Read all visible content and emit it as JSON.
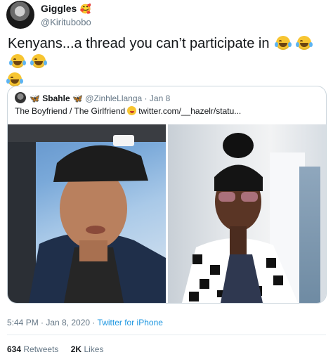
{
  "author": {
    "display_name": "Giggles",
    "name_emoji": "🥰",
    "handle": "@Kiritubobo"
  },
  "tweet": {
    "text": "Kenyans...a thread you can’t participate in"
  },
  "quoted": {
    "name": "Sbahle",
    "handle": "@ZinhleLlanga",
    "separator": "·",
    "date": "Jan 8",
    "text": "The Boyfriend / The Girlfriend",
    "link": "twitter.com/__hazelr/statu..."
  },
  "meta": {
    "time": "5:44 PM · Jan 8, 2020",
    "separator": "·",
    "source": "Twitter for iPhone"
  },
  "stats": {
    "retweets_count": "634",
    "retweets_label": "Retweets",
    "likes_count": "2K",
    "likes_label": "Likes"
  },
  "colors": {
    "text": "#14171a",
    "muted": "#657786",
    "link": "#1b95e0",
    "border": "#ccd6dd"
  }
}
